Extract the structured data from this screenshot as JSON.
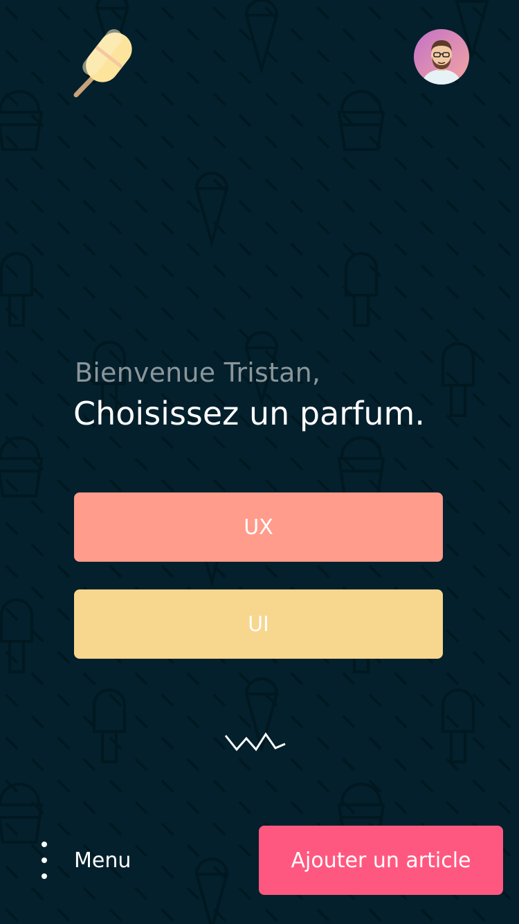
{
  "colors": {
    "background": "#03202c",
    "pattern_stroke": "#011820",
    "greeting_text": "#8b969a",
    "choice_ux": "#ff9c8c",
    "choice_ui": "#f7d68d",
    "cta": "#ff5880",
    "white": "#ffffff"
  },
  "header": {
    "logo_icon": "popsicle-icon",
    "avatar_icon": "user-avatar"
  },
  "main": {
    "greeting": "Bienvenue Tristan,",
    "headline": "Choisissez un parfum."
  },
  "choices": [
    {
      "label": "UX",
      "color": "#ff9c8c"
    },
    {
      "label": "UI",
      "color": "#f7d68d"
    }
  ],
  "scroll_indicator_icon": "zigzag-icon",
  "footer": {
    "menu_icon": "kebab-icon",
    "menu_label": "Menu",
    "cta_label": "Ajouter un article"
  }
}
